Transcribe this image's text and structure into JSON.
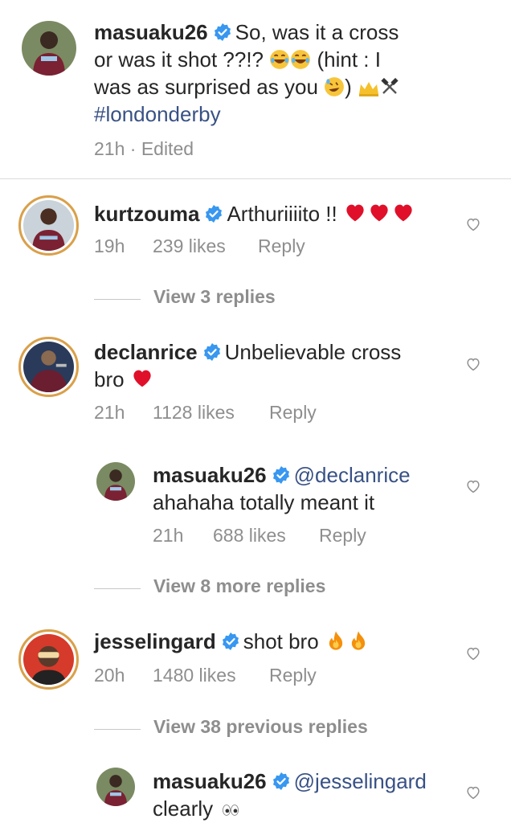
{
  "caption": {
    "username": "masuaku26",
    "text_line1": "So, was it a cross",
    "text_line2": "or was it shot ??!?",
    "text_line2b": "(hint : I",
    "text_line3": "was as surprised as you",
    "text_line3b": ")",
    "hashtag": "#londonderby",
    "time": "21h",
    "edited": "· Edited"
  },
  "comments": [
    {
      "username": "kurtzouma",
      "text": "Arthuriiiito !!",
      "time": "19h",
      "likes": "239 likes",
      "reply": "Reply",
      "view_replies": "View 3 replies"
    },
    {
      "username": "declanrice",
      "text_line1": "Unbelievable cross",
      "text_line2": "bro",
      "time": "21h",
      "likes": "1128 likes",
      "reply": "Reply",
      "view_replies": "View 8 more replies"
    },
    {
      "username": "jesselingard",
      "text": "shot bro",
      "time": "20h",
      "likes": "1480 likes",
      "reply": "Reply",
      "view_replies": "View 38 previous replies"
    }
  ],
  "replies": [
    {
      "username": "masuaku26",
      "mention": "@declanrice",
      "text": "ahahaha totally meant it",
      "time": "21h",
      "likes": "688 likes",
      "reply": "Reply"
    },
    {
      "username": "masuaku26",
      "mention": "@jesselingard",
      "text": "clearly"
    }
  ],
  "colors": {
    "heart_red": "#e0102a",
    "verified_blue": "#3897f0",
    "ring_gold": "#d9a04a",
    "meta_gray": "#8e8e8e"
  }
}
